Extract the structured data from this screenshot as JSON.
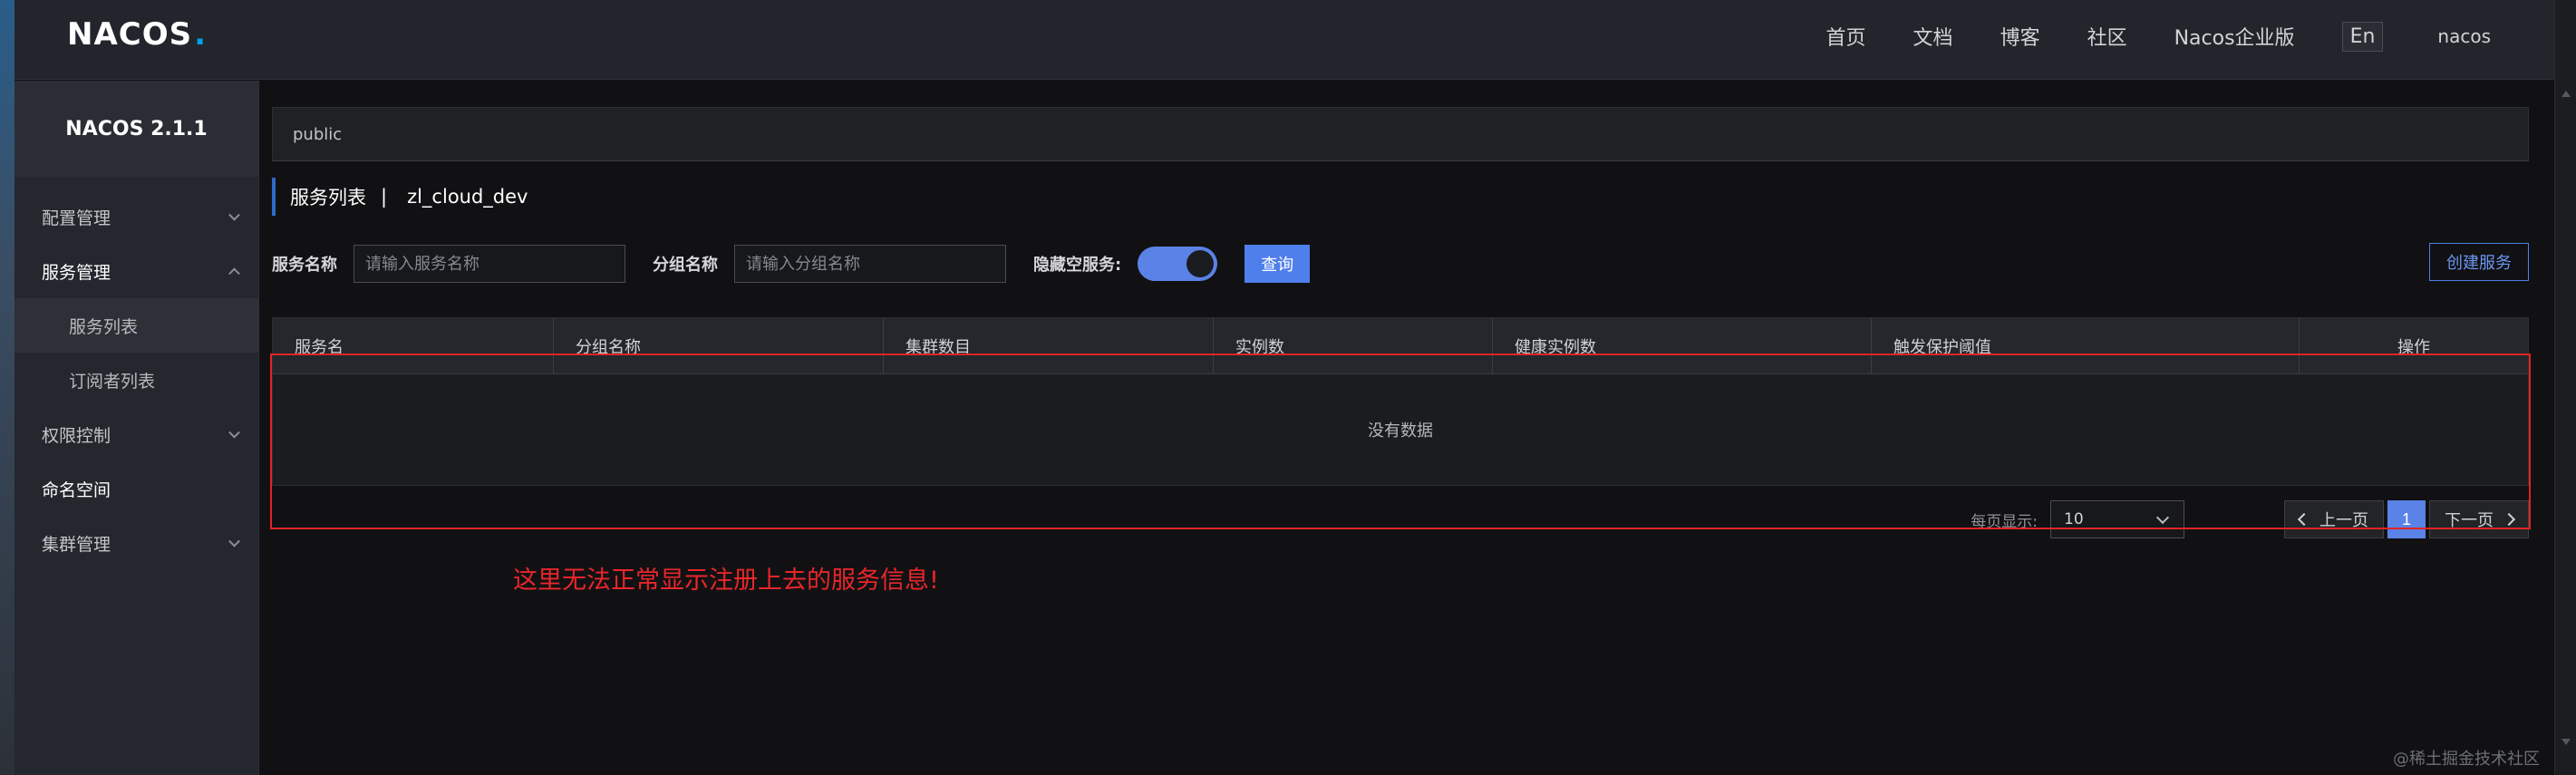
{
  "header": {
    "logo": "NACOS",
    "logo_dot": ".",
    "nav": [
      "首页",
      "文档",
      "博客",
      "社区",
      "Nacos企业版"
    ],
    "lang": "En",
    "user": "nacos"
  },
  "sidebar": {
    "version": "NACOS 2.1.1",
    "items": [
      {
        "label": "配置管理"
      },
      {
        "label": "服务管理"
      },
      {
        "label": "服务列表"
      },
      {
        "label": "订阅者列表"
      },
      {
        "label": "权限控制"
      },
      {
        "label": "命名空间"
      },
      {
        "label": "集群管理"
      }
    ]
  },
  "namespace": "public",
  "page": {
    "title": "服务列表",
    "separator": "|",
    "namespace_name": "zl_cloud_dev"
  },
  "filters": {
    "service_label": "服务名称",
    "service_placeholder": "请输入服务名称",
    "group_label": "分组名称",
    "group_placeholder": "请输入分组名称",
    "hide_empty_label": "隐藏空服务:",
    "query_label": "查询",
    "create_label": "创建服务"
  },
  "table": {
    "columns": [
      "服务名",
      "分组名称",
      "集群数目",
      "实例数",
      "健康实例数",
      "触发保护阈值",
      "操作"
    ],
    "empty_text": "没有数据"
  },
  "pagination": {
    "page_size_label": "每页显示:",
    "page_size": "10",
    "prev": "上一页",
    "current": "1",
    "next": "下一页"
  },
  "annotation": "这里无法正常显示注册上去的服务信息!",
  "watermark": "@稀土掘金技术社区",
  "colors": {
    "accent": "#5b82e6",
    "annotation_red": "#e12424"
  }
}
